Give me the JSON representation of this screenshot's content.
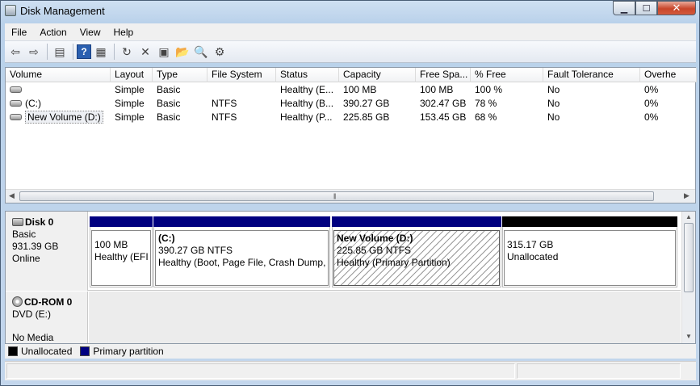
{
  "window": {
    "title": "Disk Management"
  },
  "menu": [
    "File",
    "Action",
    "View",
    "Help"
  ],
  "toolbar": [
    {
      "icon": "back-arrow-icon",
      "glyph": "⇦"
    },
    {
      "icon": "forward-arrow-icon",
      "glyph": "⇨"
    },
    {
      "sep": true
    },
    {
      "icon": "console-tree-icon",
      "glyph": "▤"
    },
    {
      "sep": true
    },
    {
      "icon": "help-icon",
      "glyph": "?"
    },
    {
      "icon": "pane-icon",
      "glyph": "▦"
    },
    {
      "sep": true
    },
    {
      "icon": "refresh-icon",
      "glyph": "↻"
    },
    {
      "icon": "delete-icon",
      "glyph": "✕"
    },
    {
      "icon": "properties-icon",
      "glyph": "▣"
    },
    {
      "icon": "open-folder-icon",
      "glyph": "📂"
    },
    {
      "icon": "search-icon",
      "glyph": "🔍"
    },
    {
      "icon": "settings-icon",
      "glyph": "⚙"
    }
  ],
  "columns": [
    "Volume",
    "Layout",
    "Type",
    "File System",
    "Status",
    "Capacity",
    "Free Spa...",
    "% Free",
    "Fault Tolerance",
    "Overhe"
  ],
  "volumes": [
    [
      "",
      "Simple",
      "Basic",
      "",
      "Healthy (E...",
      "100 MB",
      "100 MB",
      "100 %",
      "No",
      "0%"
    ],
    [
      "(C:)",
      "Simple",
      "Basic",
      "NTFS",
      "Healthy (B...",
      "390.27 GB",
      "302.47 GB",
      "78 %",
      "No",
      "0%"
    ],
    [
      "New Volume (D:)",
      "Simple",
      "Basic",
      "NTFS",
      "Healthy (P...",
      "225.85 GB",
      "153.45 GB",
      "68 %",
      "No",
      "0%"
    ]
  ],
  "disks": [
    {
      "name": "Disk 0",
      "type": "Basic",
      "size": "931.39 GB",
      "state": "Online",
      "partitions": [
        {
          "title": "",
          "line1": "100 MB",
          "line2": "Healthy (EFI",
          "color": "#000080"
        },
        {
          "title": "(C:)",
          "line1": "390.27 GB NTFS",
          "line2": "Healthy (Boot, Page File, Crash Dump,",
          "color": "#000080"
        },
        {
          "title": "New Volume  (D:)",
          "line1": "225.85 GB NTFS",
          "line2": "Healthy (Primary Partition)",
          "color": "#000080",
          "selected": true
        },
        {
          "title": "",
          "line1": "315.17 GB",
          "line2": "Unallocated",
          "color": "#000000"
        }
      ]
    },
    {
      "name": "CD-ROM 0",
      "type": "DVD (E:)",
      "state": "No Media"
    }
  ],
  "legend": [
    {
      "label": "Unallocated",
      "color": "#000000"
    },
    {
      "label": "Primary partition",
      "color": "#000080"
    }
  ]
}
